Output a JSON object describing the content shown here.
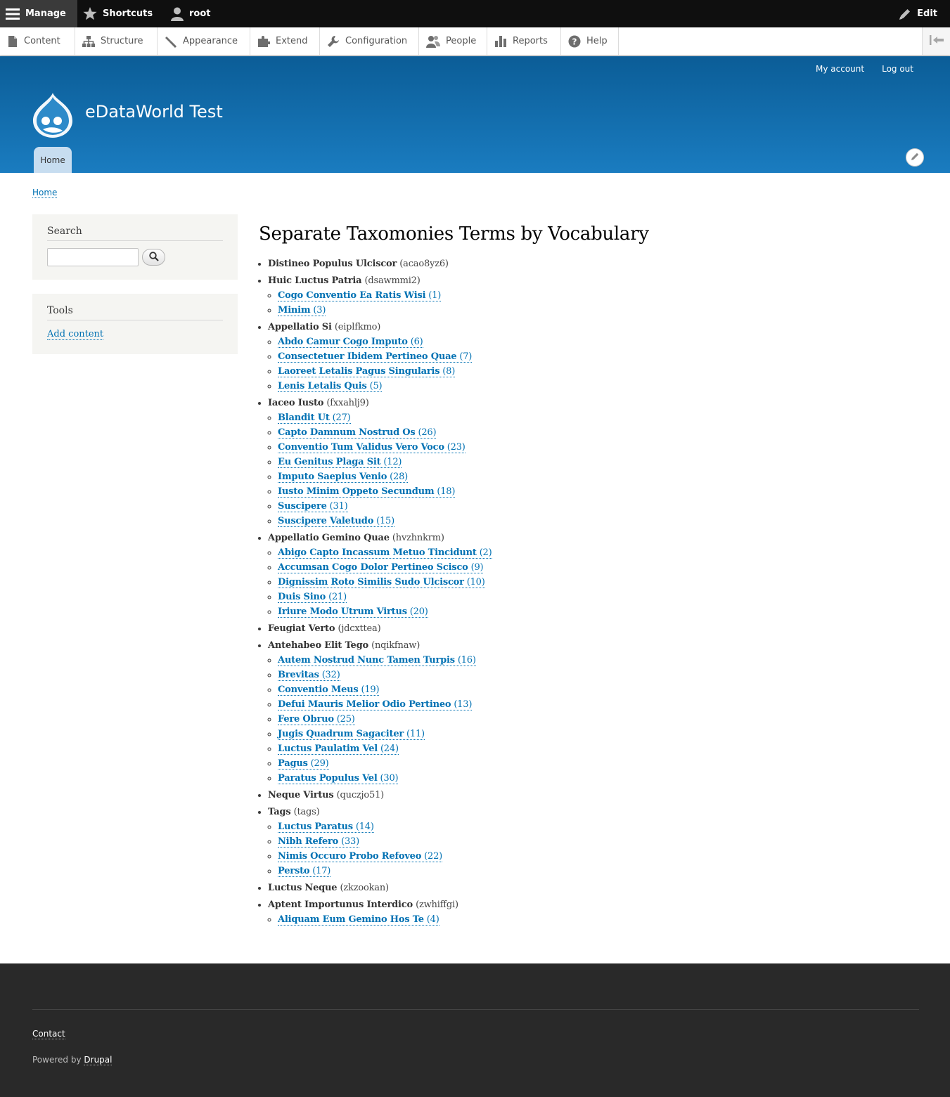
{
  "toolbar": {
    "manage_label": "Manage",
    "shortcuts_label": "Shortcuts",
    "user_label": "root",
    "edit_label": "Edit"
  },
  "tray": {
    "items": [
      {
        "label": "Content",
        "icon": "file-icon"
      },
      {
        "label": "Structure",
        "icon": "sitemap-icon"
      },
      {
        "label": "Appearance",
        "icon": "paintbrush-icon"
      },
      {
        "label": "Extend",
        "icon": "puzzle-icon"
      },
      {
        "label": "Configuration",
        "icon": "wrench-icon"
      },
      {
        "label": "People",
        "icon": "people-icon"
      },
      {
        "label": "Reports",
        "icon": "bar-chart-icon"
      },
      {
        "label": "Help",
        "icon": "help-icon"
      }
    ]
  },
  "header": {
    "my_account": "My account",
    "log_out": "Log out",
    "site_name": "eDataWorld Test",
    "home_tab": "Home",
    "brand_color": "#0b5d97"
  },
  "breadcrumb": {
    "home": "Home"
  },
  "sidebar": {
    "search_title": "Search",
    "search_value": "",
    "tools_title": "Tools",
    "add_content": "Add content"
  },
  "main": {
    "title": "Separate Taxomonies Terms by Vocabulary",
    "vocabularies": [
      {
        "name": "Distineo Populus Ulciscor",
        "machine": "(acao8yz6)",
        "terms": []
      },
      {
        "name": "Huic Luctus Patria",
        "machine": "(dsawmmi2)",
        "terms": [
          {
            "name": "Cogo Conventio Ea Ratis Wisi",
            "count": "(1)"
          },
          {
            "name": "Minim",
            "count": "(3)"
          }
        ]
      },
      {
        "name": "Appellatio Si",
        "machine": "(eiplfkmo)",
        "terms": [
          {
            "name": "Abdo Camur Cogo Imputo",
            "count": "(6)"
          },
          {
            "name": "Consectetuer Ibidem Pertineo Quae",
            "count": "(7)"
          },
          {
            "name": "Laoreet Letalis Pagus Singularis",
            "count": "(8)"
          },
          {
            "name": "Lenis Letalis Quis",
            "count": "(5)"
          }
        ]
      },
      {
        "name": "Iaceo Iusto",
        "machine": "(fxxahlj9)",
        "terms": [
          {
            "name": "Blandit Ut",
            "count": "(27)"
          },
          {
            "name": "Capto Damnum Nostrud Os",
            "count": "(26)"
          },
          {
            "name": "Conventio Tum Validus Vero Voco",
            "count": "(23)"
          },
          {
            "name": "Eu Genitus Plaga Sit",
            "count": "(12)"
          },
          {
            "name": "Imputo Saepius Venio",
            "count": "(28)"
          },
          {
            "name": "Iusto Minim Oppeto Secundum",
            "count": "(18)"
          },
          {
            "name": "Suscipere",
            "count": "(31)"
          },
          {
            "name": "Suscipere Valetudo",
            "count": "(15)"
          }
        ]
      },
      {
        "name": "Appellatio Gemino Quae",
        "machine": "(hvzhnkrm)",
        "terms": [
          {
            "name": "Abigo Capto Incassum Metuo Tincidunt",
            "count": "(2)"
          },
          {
            "name": "Accumsan Cogo Dolor Pertineo Scisco",
            "count": "(9)"
          },
          {
            "name": "Dignissim Roto Similis Sudo Ulciscor",
            "count": "(10)"
          },
          {
            "name": "Duis Sino",
            "count": "(21)"
          },
          {
            "name": "Iriure Modo Utrum Virtus",
            "count": "(20)"
          }
        ]
      },
      {
        "name": "Feugiat Verto",
        "machine": "(jdcxttea)",
        "terms": []
      },
      {
        "name": "Antehabeo Elit Tego",
        "machine": "(nqikfnaw)",
        "terms": [
          {
            "name": "Autem Nostrud Nunc Tamen Turpis",
            "count": "(16)"
          },
          {
            "name": "Brevitas",
            "count": "(32)"
          },
          {
            "name": "Conventio Meus",
            "count": "(19)"
          },
          {
            "name": "Defui Mauris Melior Odio Pertineo",
            "count": "(13)"
          },
          {
            "name": "Fere Obruo",
            "count": "(25)"
          },
          {
            "name": "Jugis Quadrum Sagaciter",
            "count": "(11)"
          },
          {
            "name": "Luctus Paulatim Vel",
            "count": "(24)"
          },
          {
            "name": "Pagus",
            "count": "(29)"
          },
          {
            "name": "Paratus Populus Vel",
            "count": "(30)"
          }
        ]
      },
      {
        "name": "Neque Virtus",
        "machine": "(quczjo51)",
        "terms": []
      },
      {
        "name": "Tags",
        "machine": "(tags)",
        "terms": [
          {
            "name": "Luctus Paratus",
            "count": "(14)"
          },
          {
            "name": "Nibh Refero",
            "count": "(33)"
          },
          {
            "name": "Nimis Occuro Probo Refoveo",
            "count": "(22)"
          },
          {
            "name": "Persto",
            "count": "(17)"
          }
        ]
      },
      {
        "name": "Luctus Neque",
        "machine": "(zkzookan)",
        "terms": []
      },
      {
        "name": "Aptent Importunus Interdico",
        "machine": "(zwhiffgi)",
        "terms": [
          {
            "name": "Aliquam Eum Gemino Hos Te",
            "count": "(4)"
          }
        ]
      }
    ]
  },
  "footer": {
    "contact": "Contact",
    "powered_by": "Powered by",
    "drupal": "Drupal"
  }
}
